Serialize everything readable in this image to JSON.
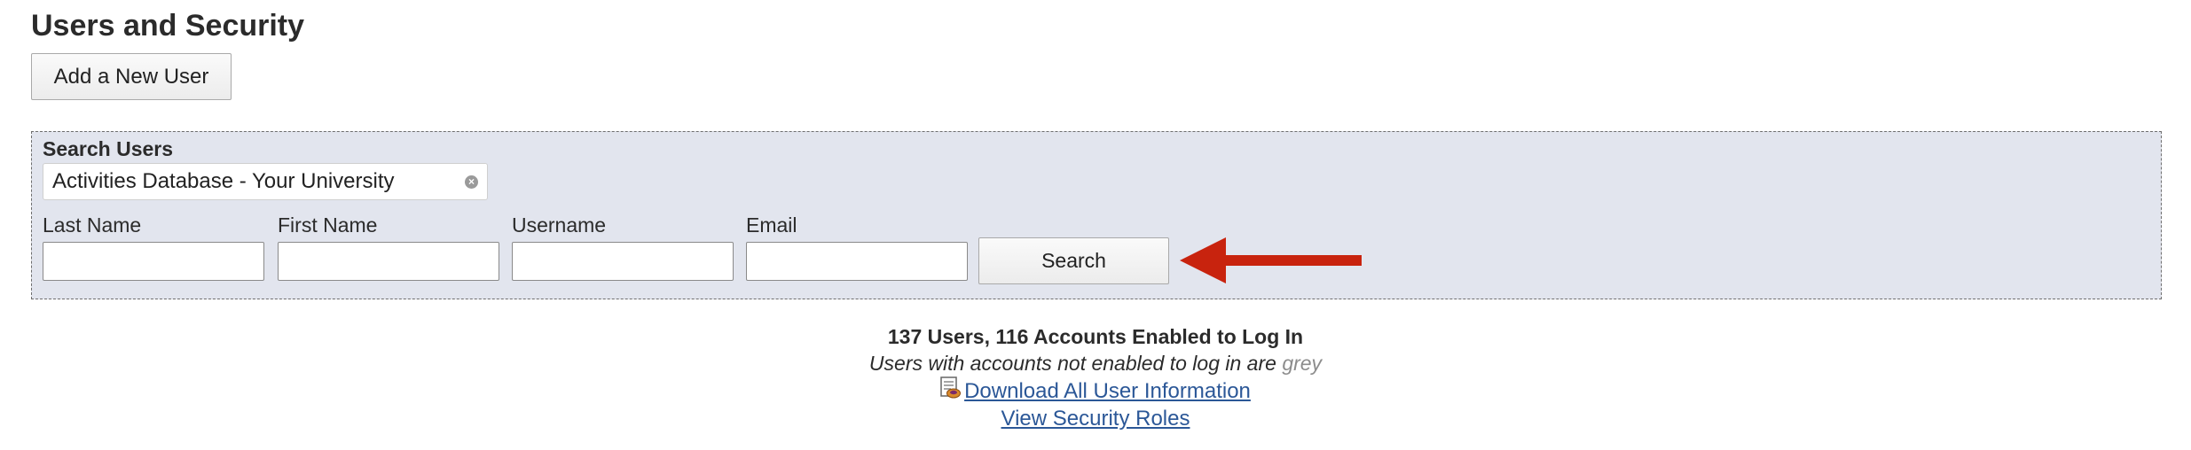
{
  "page": {
    "title": "Users and Security"
  },
  "toolbar": {
    "add_user_label": "Add a New User"
  },
  "search": {
    "heading": "Search Users",
    "database_value": "Activities Database - Your University",
    "fields": {
      "last_name": {
        "label": "Last Name",
        "value": ""
      },
      "first_name": {
        "label": "First Name",
        "value": ""
      },
      "username": {
        "label": "Username",
        "value": ""
      },
      "email": {
        "label": "Email",
        "value": ""
      }
    },
    "button_label": "Search"
  },
  "summary": {
    "counts": "137 Users, 116 Accounts Enabled to Log In",
    "note_prefix": "Users with accounts not enabled to log in are",
    "note_grey": "grey",
    "download_label": "Download All User Information",
    "roles_label": "View Security Roles"
  },
  "icons": {
    "clear": "clear-icon",
    "download": "spreadsheet-download-icon",
    "annotation": "red-arrow-icon"
  },
  "colors": {
    "panel_bg": "#e2e5ee",
    "link": "#2b5797",
    "arrow": "#c8230e",
    "disabled_text": "#8c8c8c"
  }
}
